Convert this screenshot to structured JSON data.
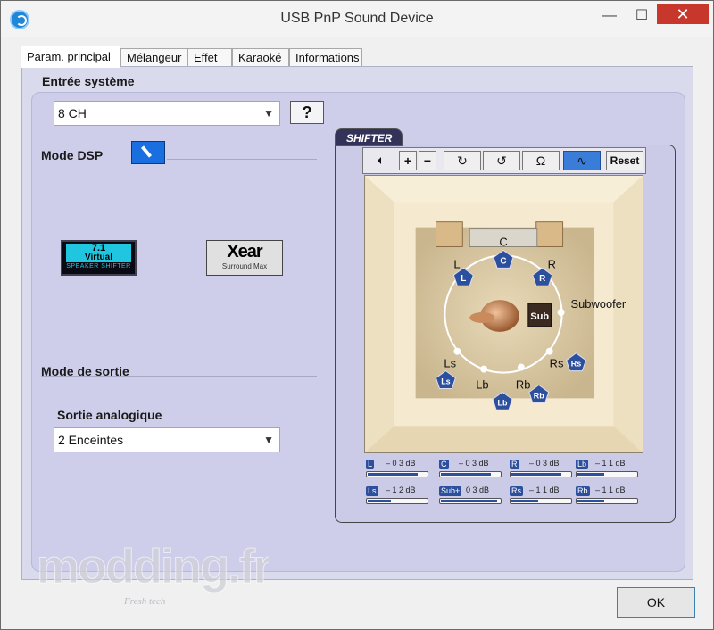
{
  "window": {
    "title": "USB PnP Sound Device"
  },
  "tabs": [
    "Param. principal",
    "Mélangeur",
    "Effet",
    "Karaoké",
    "Informations"
  ],
  "entree": {
    "heading": "Entrée système",
    "select_value": "8 CH",
    "help_label": "?"
  },
  "dsp": {
    "heading": "Mode DSP"
  },
  "logos": {
    "virtual_line1": "7.1",
    "virtual_line2": "Virtual",
    "virtual_line3": "SPEAKER SHIFTER",
    "xear_line1": "Xear",
    "xear_line2": "Surround Max"
  },
  "sortie": {
    "heading": "Mode de sortie",
    "sub_heading": "Sortie analogique",
    "select_value": "2 Enceintes"
  },
  "shifter": {
    "tab_label": "SHIFTER",
    "reset_label": "Reset",
    "speakers": {
      "C": "C",
      "L": "L",
      "R": "R",
      "Sub": "Sub",
      "Ls": "Ls",
      "Rs": "Rs",
      "Lb": "Lb",
      "Rb": "Rb"
    },
    "labels": {
      "C": "C",
      "L": "L",
      "R": "R",
      "Subwoofer": "Subwoofer",
      "Ls": "Ls",
      "Rs": "Rs",
      "Lb": "Lb",
      "Rb": "Rb"
    },
    "levels": [
      {
        "name": "L",
        "value": "– 0 3 dB",
        "fraction": 0.85
      },
      {
        "name": "C",
        "value": "– 0 3 dB",
        "fraction": 0.85
      },
      {
        "name": "R",
        "value": "– 0 3 dB",
        "fraction": 0.85
      },
      {
        "name": "Lb",
        "value": "– 1 1 dB",
        "fraction": 0.45
      },
      {
        "name": "Ls",
        "value": "– 1 2 dB",
        "fraction": 0.4
      },
      {
        "name": "Sub+",
        "value": "0 3 dB",
        "fraction": 0.95
      },
      {
        "name": "Rs",
        "value": "– 1 1 dB",
        "fraction": 0.45
      },
      {
        "name": "Rb",
        "value": "– 1 1 dB",
        "fraction": 0.45
      }
    ]
  },
  "footer": {
    "ok_label": "OK"
  },
  "watermark": {
    "main": "modding.fr",
    "sub": "Fresh tech"
  },
  "colors": {
    "accent": "#2c4f9e",
    "close": "#c7372b",
    "panel": "#ceceea"
  }
}
